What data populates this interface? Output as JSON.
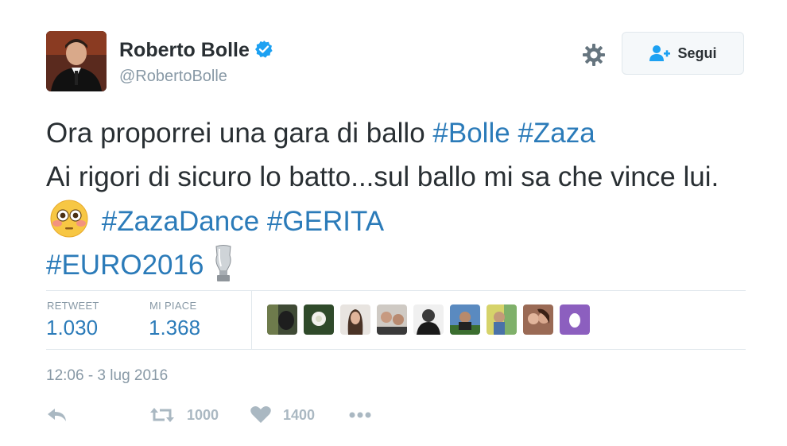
{
  "user": {
    "name": "Roberto Bolle",
    "handle": "@RobertoBolle",
    "verified_icon": "verified-badge-icon",
    "avatar_icon": "user-avatar"
  },
  "header": {
    "settings_icon": "gear-icon",
    "follow_label": "Segui",
    "follow_icon": "add-user-icon"
  },
  "tweet": {
    "t1": "Ora proporrei una gara di ballo ",
    "h1": "#Bolle",
    "h2": "#Zaza",
    "t2": "Ai rigori di sicuro lo batto...sul ballo mi sa che vince lui. ",
    "emoji": "flushed-face-emoji",
    "h3": "#ZazaDance",
    "h4": "#GERITA",
    "h5": "#EURO2016",
    "trophy": "trophy-emoji"
  },
  "stats": {
    "retweet_label": "RETWEET",
    "retweet_value": "1.030",
    "like_label": "MI PIACE",
    "like_value": "1.368",
    "likers_count": 9
  },
  "timestamp": "12:06 - 3 lug 2016",
  "actions": {
    "reply_icon": "reply-icon",
    "retweet_icon": "retweet-icon",
    "retweet_count": "1000",
    "like_icon": "heart-icon",
    "like_count": "1400",
    "more_icon": "more-icon"
  },
  "colors": {
    "hashtag": "#2b7bb9",
    "verified": "#1da1f2",
    "muted": "#8899a6",
    "action": "#aab8c2"
  }
}
